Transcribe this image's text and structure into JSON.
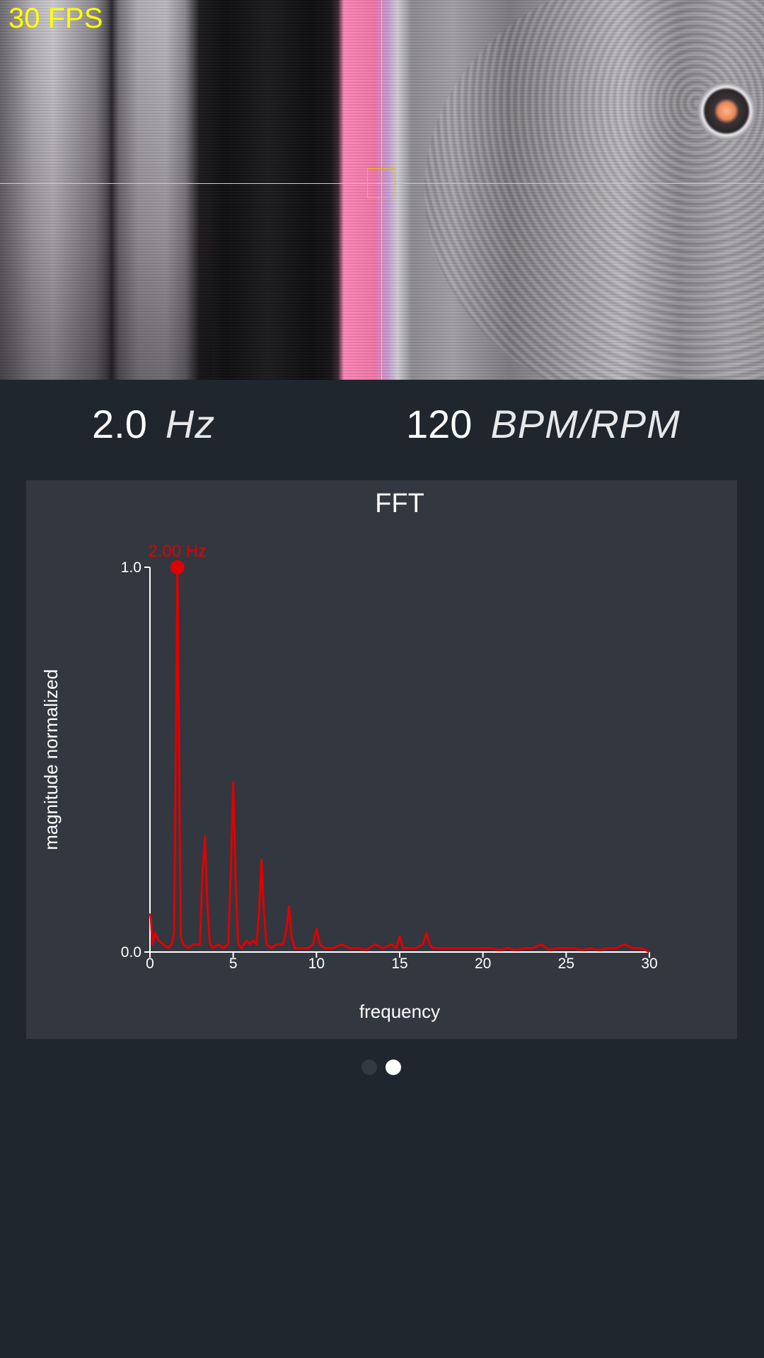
{
  "camera": {
    "fps_label": "30 FPS"
  },
  "readouts": {
    "frequency_value": "2.0",
    "frequency_unit": "Hz",
    "bpm_value": "120",
    "bpm_unit": "BPM/RPM"
  },
  "colors": {
    "background": "#20262e",
    "card": "#333740",
    "series": "#e00000",
    "overlay": "#ffff00"
  },
  "chart_data": {
    "type": "line",
    "title": "FFT",
    "xlabel": "frequency",
    "ylabel": "magnitude normalized",
    "xlim": [
      0,
      30
    ],
    "ylim": [
      0,
      1
    ],
    "x_ticks": [
      "0",
      "5",
      "10",
      "15",
      "20",
      "25",
      "30"
    ],
    "y_ticks": [
      "0.0",
      "1.0"
    ],
    "peak": {
      "x": 1.65,
      "y": 1.0,
      "label": "2.00 Hz"
    },
    "grid": false,
    "series": [
      {
        "x": [
          0.0,
          0.05,
          0.15,
          0.3,
          0.5,
          0.8,
          1.1,
          1.3,
          1.45,
          1.55,
          1.65,
          1.75,
          1.85,
          2.0,
          2.3,
          2.6,
          3.0,
          3.15,
          3.3,
          3.45,
          3.6,
          3.8,
          4.1,
          4.4,
          4.7,
          4.85,
          5.0,
          5.15,
          5.3,
          5.5,
          5.8,
          6.0,
          6.2,
          6.4,
          6.55,
          6.7,
          6.85,
          7.0,
          7.3,
          7.6,
          8.0,
          8.2,
          8.35,
          8.5,
          8.7,
          9.0,
          9.5,
          9.8,
          10.0,
          10.2,
          10.5,
          11.0,
          11.5,
          12.0,
          12.5,
          13.0,
          13.5,
          14.0,
          14.5,
          14.8,
          15.0,
          15.2,
          15.6,
          16.0,
          16.4,
          16.6,
          16.8,
          17.0,
          17.5,
          18.0,
          18.5,
          19.0,
          19.5,
          20.0,
          20.5,
          21.0,
          21.5,
          22.0,
          22.5,
          23.0,
          23.5,
          24.0,
          24.5,
          25.0,
          25.5,
          26.0,
          26.5,
          27.0,
          27.5,
          28.0,
          28.5,
          29.0,
          29.5,
          30.0
        ],
        "y": [
          0.1,
          0.09,
          0.02,
          0.05,
          0.03,
          0.02,
          0.01,
          0.02,
          0.05,
          0.5,
          1.0,
          0.5,
          0.04,
          0.02,
          0.01,
          0.02,
          0.02,
          0.2,
          0.3,
          0.12,
          0.02,
          0.01,
          0.02,
          0.01,
          0.02,
          0.2,
          0.44,
          0.18,
          0.02,
          0.01,
          0.03,
          0.02,
          0.03,
          0.02,
          0.1,
          0.24,
          0.1,
          0.02,
          0.01,
          0.02,
          0.02,
          0.06,
          0.12,
          0.04,
          0.01,
          0.01,
          0.01,
          0.02,
          0.06,
          0.02,
          0.01,
          0.01,
          0.02,
          0.01,
          0.01,
          0.005,
          0.02,
          0.01,
          0.02,
          0.01,
          0.04,
          0.01,
          0.01,
          0.01,
          0.02,
          0.05,
          0.02,
          0.01,
          0.01,
          0.01,
          0.01,
          0.01,
          0.01,
          0.01,
          0.01,
          0.005,
          0.01,
          0.005,
          0.01,
          0.01,
          0.02,
          0.005,
          0.01,
          0.01,
          0.01,
          0.005,
          0.01,
          0.005,
          0.01,
          0.01,
          0.02,
          0.01,
          0.01,
          0.0
        ]
      }
    ]
  }
}
